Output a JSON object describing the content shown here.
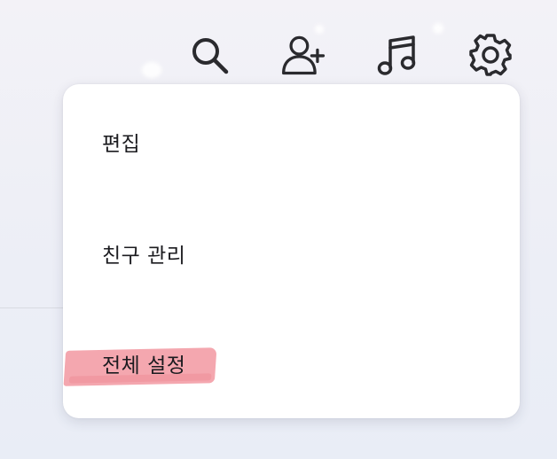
{
  "toolbar": {
    "icons": [
      "search-icon",
      "add-friend-icon",
      "music-icon",
      "settings-icon"
    ]
  },
  "menu": {
    "items": [
      {
        "label": "편집"
      },
      {
        "label": "친구 관리"
      },
      {
        "label": "전체 설정",
        "highlighted": true
      }
    ]
  },
  "colors": {
    "highlight": "#f4a3ab",
    "text": "#1b1b1f",
    "icon": "#2a2a2e"
  }
}
